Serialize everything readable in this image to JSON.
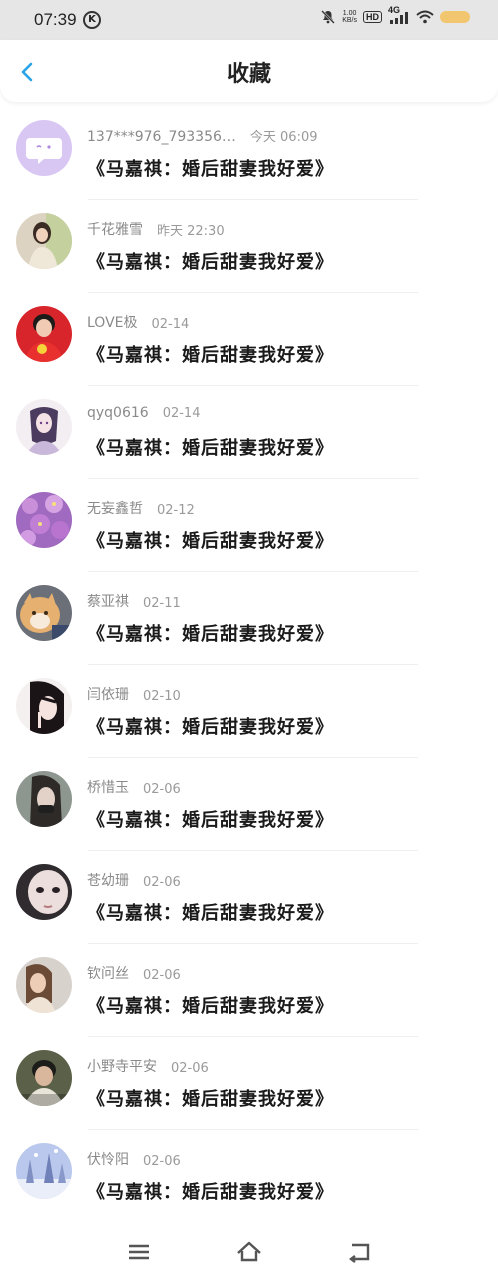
{
  "status": {
    "time": "07:39",
    "k_icon": "K",
    "speed_top": "1.00",
    "speed_bottom": "KB/s",
    "hd": "HD",
    "net": "4G",
    "battery_color": "#f2c66e"
  },
  "header": {
    "title": "收藏",
    "back_icon": "chevron-left-icon",
    "accent": "#2aa3e6"
  },
  "items": [
    {
      "name": "137***976_793356…",
      "time": "今天 06:09",
      "book": "《马嘉祺：婚后甜妻我好爱》"
    },
    {
      "name": "千花雅雪",
      "time": "昨天 22:30",
      "book": "《马嘉祺：婚后甜妻我好爱》"
    },
    {
      "name": "LOVE极",
      "time": "02-14",
      "book": "《马嘉祺：婚后甜妻我好爱》"
    },
    {
      "name": "qyq0616",
      "time": "02-14",
      "book": "《马嘉祺：婚后甜妻我好爱》"
    },
    {
      "name": "无妄鑫哲",
      "time": "02-12",
      "book": "《马嘉祺：婚后甜妻我好爱》"
    },
    {
      "name": "蔡亚祺",
      "time": "02-11",
      "book": "《马嘉祺：婚后甜妻我好爱》"
    },
    {
      "name": "闫依珊",
      "time": "02-10",
      "book": "《马嘉祺：婚后甜妻我好爱》"
    },
    {
      "name": "桥惜玉",
      "time": "02-06",
      "book": "《马嘉祺：婚后甜妻我好爱》"
    },
    {
      "name": "苍幼珊",
      "time": "02-06",
      "book": "《马嘉祺：婚后甜妻我好爱》"
    },
    {
      "name": "钦问丝",
      "time": "02-06",
      "book": "《马嘉祺：婚后甜妻我好爱》"
    },
    {
      "name": "小野寺平安",
      "time": "02-06",
      "book": "《马嘉祺：婚后甜妻我好爱》"
    },
    {
      "name": "伏怜阳",
      "time": "02-06",
      "book": "《马嘉祺：婚后甜妻我好爱》"
    }
  ],
  "navbar": {
    "menu_icon": "menu-icon",
    "home_icon": "home-icon",
    "back_icon": "back-icon"
  }
}
